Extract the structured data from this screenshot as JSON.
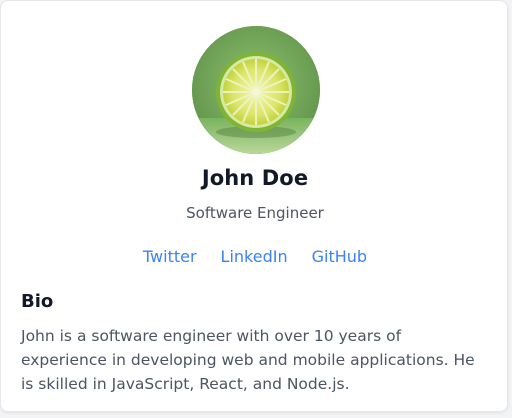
{
  "profile": {
    "name": "John Doe",
    "title": "Software Engineer",
    "avatar_icon": "lime-slice-photo"
  },
  "social_links": [
    {
      "label": "Twitter"
    },
    {
      "label": "LinkedIn"
    },
    {
      "label": "GitHub"
    }
  ],
  "bio": {
    "heading": "Bio",
    "text": "John is a software engineer with over 10 years of experience in developing web and mobile applications. He is skilled in JavaScript, React, and Node.js."
  },
  "colors": {
    "link": "#3b82f6",
    "heading": "#111827",
    "body_text": "#4b5563",
    "avatar_bg": "#6da557"
  }
}
